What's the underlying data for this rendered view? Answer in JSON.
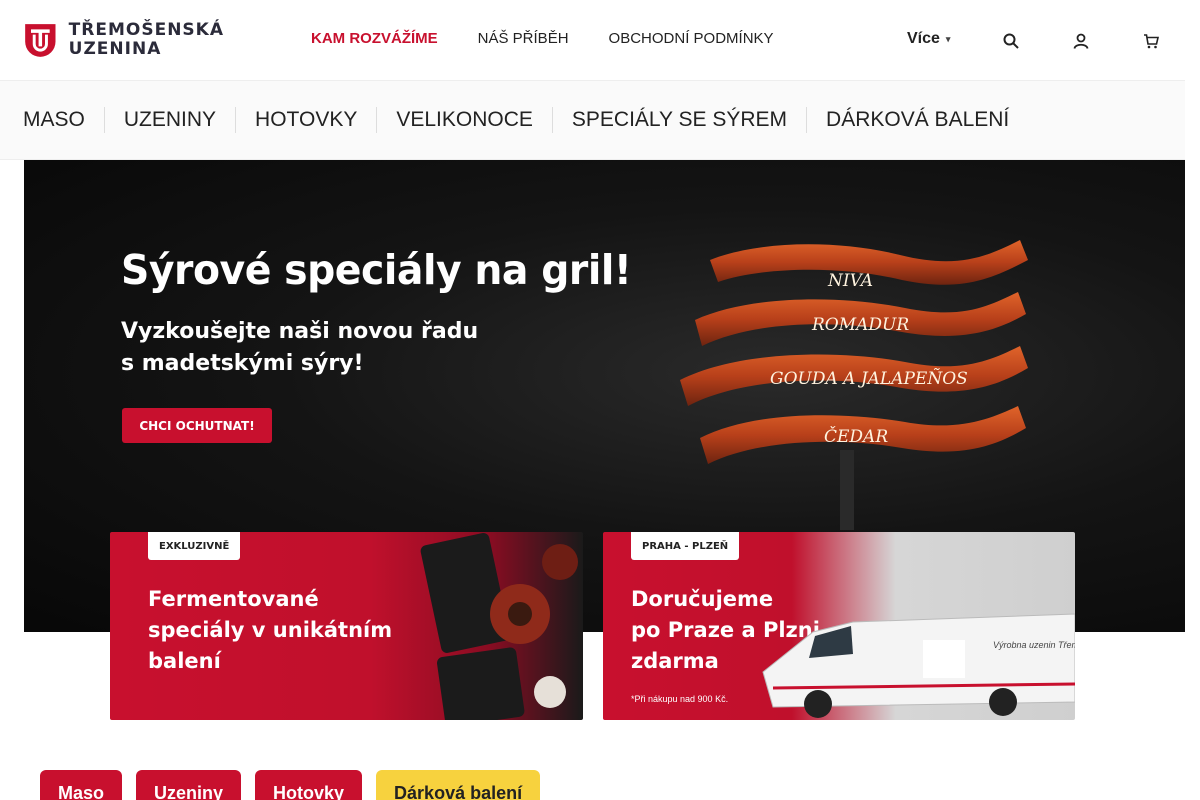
{
  "brand": {
    "name_line1": "TŘEMOŠENSKÁ",
    "name_line2": "UZENINA",
    "red": "#c8102e",
    "yellow": "#f7d23e"
  },
  "header": {
    "links": [
      {
        "label": "KAM ROZVÁŽÍME",
        "active": true
      },
      {
        "label": "NÁŠ PŘÍBĚH",
        "active": false
      },
      {
        "label": "OBCHODNÍ PODMÍNKY",
        "active": false
      }
    ],
    "more_label": "Více",
    "icons": [
      "search-icon",
      "user-icon",
      "cart-icon"
    ]
  },
  "categories": [
    "MASO",
    "UZENINY",
    "HOTOVKY",
    "VELIKONOCE",
    "SPECIÁLY SE SÝREM",
    "DÁRKOVÁ BALENÍ"
  ],
  "hero": {
    "title": "Sýrové speciály na gril!",
    "subtitle_line1": "Vyzkoušejte naši novou řadu",
    "subtitle_line2": "s madetskými sýry!",
    "cta": "CHCI OCHUTNAT!",
    "sausage_labels": [
      "NIVA",
      "ROMADUR",
      "GOUDA A JALAPEÑOS",
      "ČEDAR"
    ]
  },
  "promos": [
    {
      "badge": "EXKLUZIVNĚ",
      "lines": [
        "Fermentované",
        "speciály v unikátním",
        "balení"
      ]
    },
    {
      "badge": "PRAHA - PLZEŇ",
      "lines": [
        "Doručujeme",
        "po Praze a Plzni",
        "zdarma"
      ],
      "note": "*Při nákupu nad 900 Kč.",
      "van_text": "Výrobna uzenin Třemošná"
    }
  ],
  "product_tabs": [
    {
      "label": "Maso",
      "active": false
    },
    {
      "label": "Uzeniny",
      "active": false
    },
    {
      "label": "Hotovky",
      "active": false
    },
    {
      "label": "Dárková balení",
      "active": true
    }
  ]
}
